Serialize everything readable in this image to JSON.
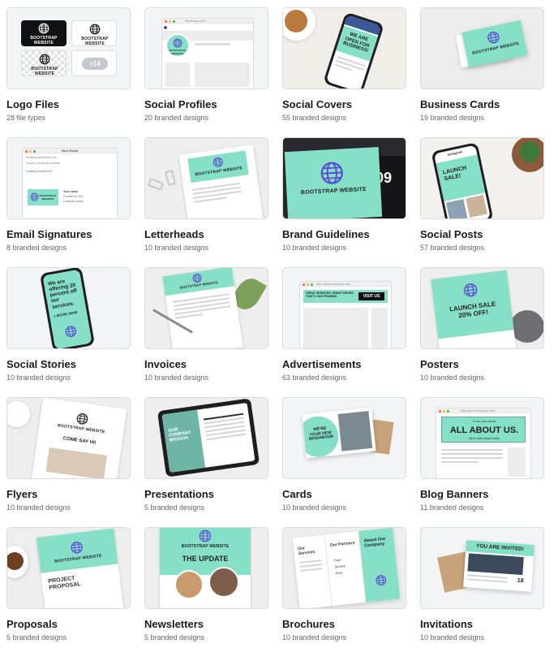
{
  "cards": [
    {
      "title": "Logo Files",
      "subtitle": "28 file types"
    },
    {
      "title": "Social Profiles",
      "subtitle": "20 branded designs"
    },
    {
      "title": "Social Covers",
      "subtitle": "55 branded designs"
    },
    {
      "title": "Business Cards",
      "subtitle": "19 branded designs"
    },
    {
      "title": "Email Signatures",
      "subtitle": "8 branded designs"
    },
    {
      "title": "Letterheads",
      "subtitle": "10 branded designs"
    },
    {
      "title": "Brand Guidelines",
      "subtitle": "10 branded designs"
    },
    {
      "title": "Social Posts",
      "subtitle": "57 branded designs"
    },
    {
      "title": "Social Stories",
      "subtitle": "10 branded designs"
    },
    {
      "title": "Invoices",
      "subtitle": "10 branded designs"
    },
    {
      "title": "Advertisements",
      "subtitle": "63 branded designs"
    },
    {
      "title": "Posters",
      "subtitle": "10 branded designs"
    },
    {
      "title": "Flyers",
      "subtitle": "10 branded designs"
    },
    {
      "title": "Presentations",
      "subtitle": "5 branded designs"
    },
    {
      "title": "Cards",
      "subtitle": "10 branded designs"
    },
    {
      "title": "Blog Banners",
      "subtitle": "11 branded designs"
    },
    {
      "title": "Proposals",
      "subtitle": "5 branded designs"
    },
    {
      "title": "Newsletters",
      "subtitle": "5 branded designs"
    },
    {
      "title": "Brochures",
      "subtitle": "10 branded designs"
    },
    {
      "title": "Invitations",
      "subtitle": "10 branded designs"
    }
  ],
  "mockups": {
    "brand_name": "BOOTSTRAP WEBSITE",
    "logo_files_more": "+14",
    "social_profiles_url": "facebook.com",
    "social_covers_text": "WE ARE OPEN FOR BUSINESS!",
    "email_window_title": "New Email",
    "email_to": "bootstrap@website.com",
    "email_subject": "Subject: Bootstrap Website",
    "email_body": "Looking forward to it!",
    "email_sig_name": "Your name",
    "email_sig_role": "Founder & CEO",
    "email_sig_company": "Company name",
    "brand_guidelines_num": "09",
    "social_posts_app": "Instagram",
    "social_posts_text": "LAUNCH SALE!",
    "social_stories_text": "We are offering 20 percent off our services.",
    "social_stories_cta": "+ BOOK NOW",
    "ads_url": "http://yourcompany.com",
    "ads_banner_text": "GREAT SERVICES. GREAT PRICES. THAT'S OUR PROMISE.",
    "ads_cta": "VISIT US",
    "posters_text": "LAUNCH SALE 20% OFF!",
    "flyers_text": "COME SAY HI!",
    "presentations_text": "OUR COMPANY MISSION",
    "cards_text": "WE'RE YOUR NEW NEIGHBOUR",
    "blog_url": "http://yourcompany.com",
    "blog_small": "To our new friends",
    "blog_title": "ALL ABOUT US.",
    "blog_sub": "We're quite alright really!",
    "proposal_text": "PROJECT PROPOSAL",
    "newsletter_title": "THE UPDATE",
    "brochure_services": "Our Services",
    "brochure_partners": "Our Partners",
    "brochure_about": "About Our Company",
    "brochure_items": [
      "Care",
      "Service",
      "Price"
    ],
    "invite_text": "YOU ARE INVITED!",
    "invite_date": "18"
  },
  "colors": {
    "mint": "#86e0c8",
    "globe": "#5b4bd6",
    "dark": "#1e1e22",
    "text": "#1a1a1a",
    "muted": "#666666"
  }
}
